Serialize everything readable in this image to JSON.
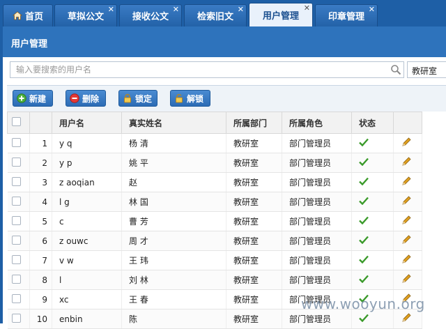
{
  "tabs": [
    {
      "label": "首页",
      "icon": "home-icon",
      "closable": false,
      "active": false
    },
    {
      "label": "草拟公文",
      "closable": true,
      "active": false
    },
    {
      "label": "接收公文",
      "closable": true,
      "active": false
    },
    {
      "label": "检索旧文",
      "closable": true,
      "active": false
    },
    {
      "label": "用户管理",
      "closable": true,
      "active": true
    },
    {
      "label": "印章管理",
      "closable": true,
      "active": false
    }
  ],
  "close_glyph": "✕",
  "panel_title": "用户管理",
  "search": {
    "placeholder": "输入要搜索的用户名",
    "value": ""
  },
  "department_select": {
    "value": "教研室"
  },
  "toolbar": {
    "new_label": "新建",
    "delete_label": "删除",
    "lock_label": "锁定",
    "unlock_label": "解锁"
  },
  "columns": {
    "username": "用户名",
    "realname": "真实姓名",
    "department": "所属部门",
    "role": "所属角色",
    "status": "状态"
  },
  "rows": [
    {
      "no": "1",
      "username": "y  q",
      "realname": "杨    清",
      "department": "教研室",
      "role": "部门管理员",
      "status": "active"
    },
    {
      "no": "2",
      "username": "y  p",
      "realname": "姚    平",
      "department": "教研室",
      "role": "部门管理员",
      "status": "active"
    },
    {
      "no": "3",
      "username": "z  aoqian",
      "realname": "赵",
      "department": "教研室",
      "role": "部门管理员",
      "status": "active"
    },
    {
      "no": "4",
      "username": "l  g",
      "realname": "林    国",
      "department": "教研室",
      "role": "部门管理员",
      "status": "active"
    },
    {
      "no": "5",
      "username": "c",
      "realname": "曹    芳",
      "department": "教研室",
      "role": "部门管理员",
      "status": "active"
    },
    {
      "no": "6",
      "username": "z  ouwc",
      "realname": "周    才",
      "department": "教研室",
      "role": "部门管理员",
      "status": "active"
    },
    {
      "no": "7",
      "username": "v  w",
      "realname": "王    玮",
      "department": "教研室",
      "role": "部门管理员",
      "status": "active"
    },
    {
      "no": "8",
      "username": "l",
      "realname": "刘    林",
      "department": "教研室",
      "role": "部门管理员",
      "status": "active"
    },
    {
      "no": "9",
      "username": "  xc",
      "realname": "王    春",
      "department": "教研室",
      "role": "部门管理员",
      "status": "active"
    },
    {
      "no": "10",
      "username": "  enbin",
      "realname": "陈",
      "department": "教研室",
      "role": "部门管理员",
      "status": "active"
    }
  ],
  "watermark": "www.wooyun.org",
  "colors": {
    "accent": "#2e73bc",
    "check": "#3a9a2a",
    "pencil": "#e0a020"
  }
}
